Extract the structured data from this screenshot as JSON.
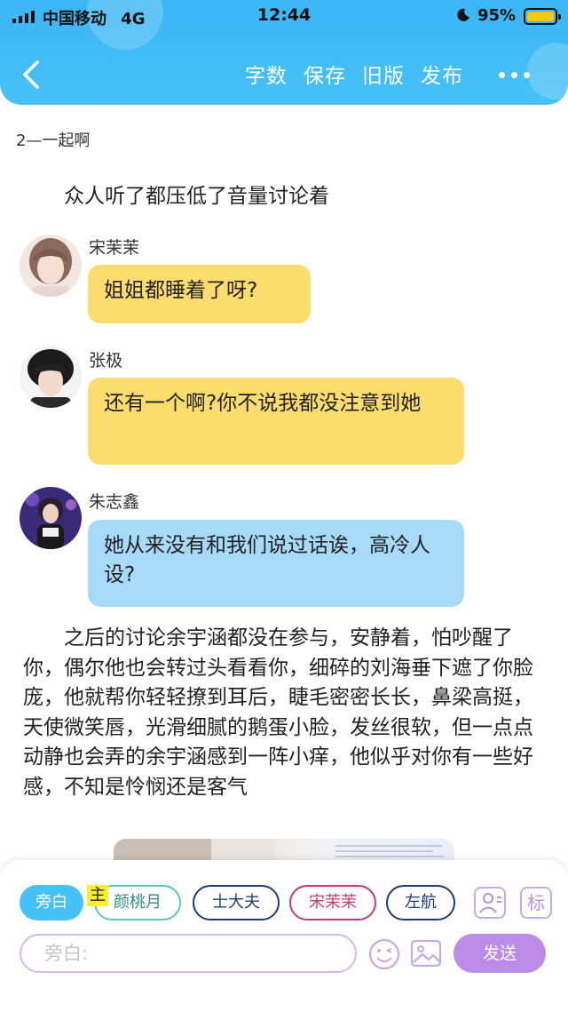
{
  "status_bar": {
    "carrier": "中国移动",
    "network": "4G",
    "time": "12:44",
    "battery": "95%"
  },
  "nav": {
    "actions": [
      "字数",
      "保存",
      "旧版",
      "发布"
    ]
  },
  "chapter_title": "2—一起啊",
  "narration_1": "众人听了都压低了音量讨论着",
  "messages": [
    {
      "speaker": "宋茉茉",
      "text": "姐姐都睡着了呀?",
      "color": "#fddc6e"
    },
    {
      "speaker": "张极",
      "text": "还有一个啊?你不说我都没注意到她",
      "color": "#fddc6e"
    },
    {
      "speaker": "朱志鑫",
      "text": "她从来没有和我们说过话诶，高冷人设?",
      "color": "#a7daf8"
    }
  ],
  "narration_2": "之后的讨论余宇涵都没在参与，安静着，怕吵醒了你，偶尔他也会转过头看看你，细碎的刘海垂下遮了你脸庞，他就帮你轻轻撩到耳后，睫毛密密长长，鼻梁高挺，天使微笑唇，光滑细腻的鹅蛋小脸，发丝很软，但一点点动静也会弄的余宇涵感到一阵小痒，他似乎对你有一些好感，不知是怜悯还是客气",
  "composer": {
    "roles": [
      {
        "label": "旁白",
        "style": "active"
      },
      {
        "label": "颜桃月",
        "style": "teal",
        "badge": "主"
      },
      {
        "label": "士大夫",
        "style": "navy"
      },
      {
        "label": "宋茉茉",
        "style": "pink"
      },
      {
        "label": "左航",
        "style": "navy"
      }
    ],
    "tag_icon_label": "标",
    "input_placeholder": "旁白:",
    "send_label": "发送"
  }
}
